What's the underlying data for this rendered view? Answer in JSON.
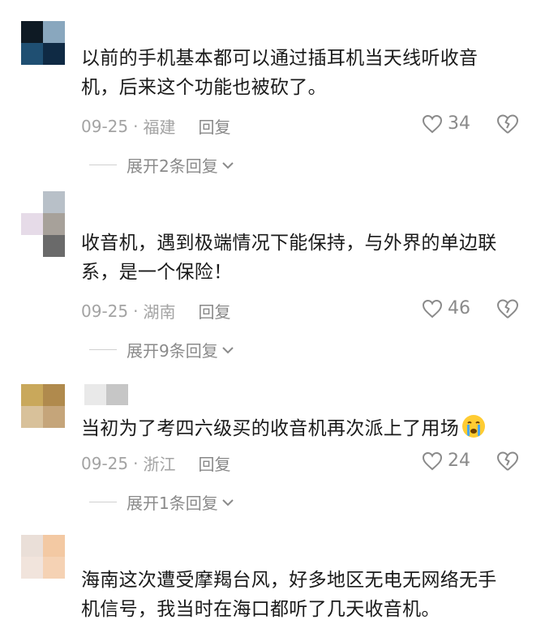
{
  "comments": [
    {
      "avatar_colors": [
        "#0e1a24",
        "#89a7be",
        "#1f4f72",
        "#0f2a44"
      ],
      "text_line1": "以前的手机基本都可以通过插耳机当天线听收音",
      "text_line2": "机，后来这个功能也被砍了。",
      "date": "09-25",
      "location": "福建",
      "reply_label": "回复",
      "likes": "34",
      "expand_label": "展开2条回复"
    },
    {
      "avatar_colors": [
        "#ffffff",
        "#b8c0c8",
        "#e6dbe8",
        "#a7a19a",
        "#ffffff",
        "#6a6a6a"
      ],
      "text_line1": "收音机，遇到极端情况下能保持，与外界的单边联",
      "text_line2": "系，是一个保险！",
      "date": "09-25",
      "location": "湖南",
      "reply_label": "回复",
      "likes": "46",
      "expand_label": "展开9条回复"
    },
    {
      "avatar_colors": [
        "#c9a85b",
        "#b08a4d",
        "#d8c19a",
        "#c5a57a"
      ],
      "name_colors": [
        "#e9e9e9",
        "#c6c6c6"
      ],
      "text_line1": "当初为了考四六级买的收音机再次派上了用场",
      "emoji": "crying-face",
      "date": "09-25",
      "location": "浙江",
      "reply_label": "回复",
      "likes": "24",
      "expand_label": "展开1条回复"
    },
    {
      "avatar_colors": [
        "#eadfd8",
        "#f3c9a3",
        "#f1e4dc",
        "#f5d2b4"
      ],
      "text_line1": "海南这次遭受摩羯台风，好多地区无电无网络无手",
      "text_line2": "机信号，我当时在海口都听了几天收音机。"
    }
  ],
  "separator": "·"
}
